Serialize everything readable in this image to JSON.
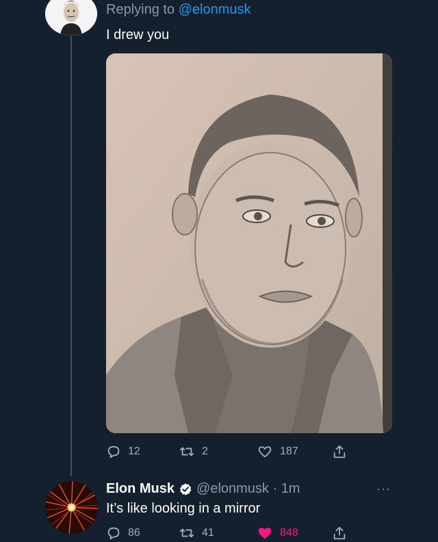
{
  "reply": {
    "replying_prefix": "Replying to",
    "replying_handle": "@elonmusk",
    "text": "I drew you",
    "stats": {
      "replies": "12",
      "retweets": "2",
      "likes": "187"
    }
  },
  "response": {
    "name": "Elon Musk",
    "handle_time": "@elonmusk · 1m",
    "more": "···",
    "text": "It’s like looking in a mirror",
    "stats": {
      "replies": "86",
      "retweets": "41",
      "likes": "848",
      "liked": true
    }
  },
  "icons": {
    "reply": "reply-icon",
    "retweet": "retweet-icon",
    "like": "heart-icon",
    "share": "share-icon",
    "verified": "verified-badge-icon",
    "more": "more-icon"
  },
  "colors": {
    "background": "#14202d",
    "link": "#1d9bf0",
    "secondary_text": "#8b98a5",
    "like_active": "#f91880"
  }
}
